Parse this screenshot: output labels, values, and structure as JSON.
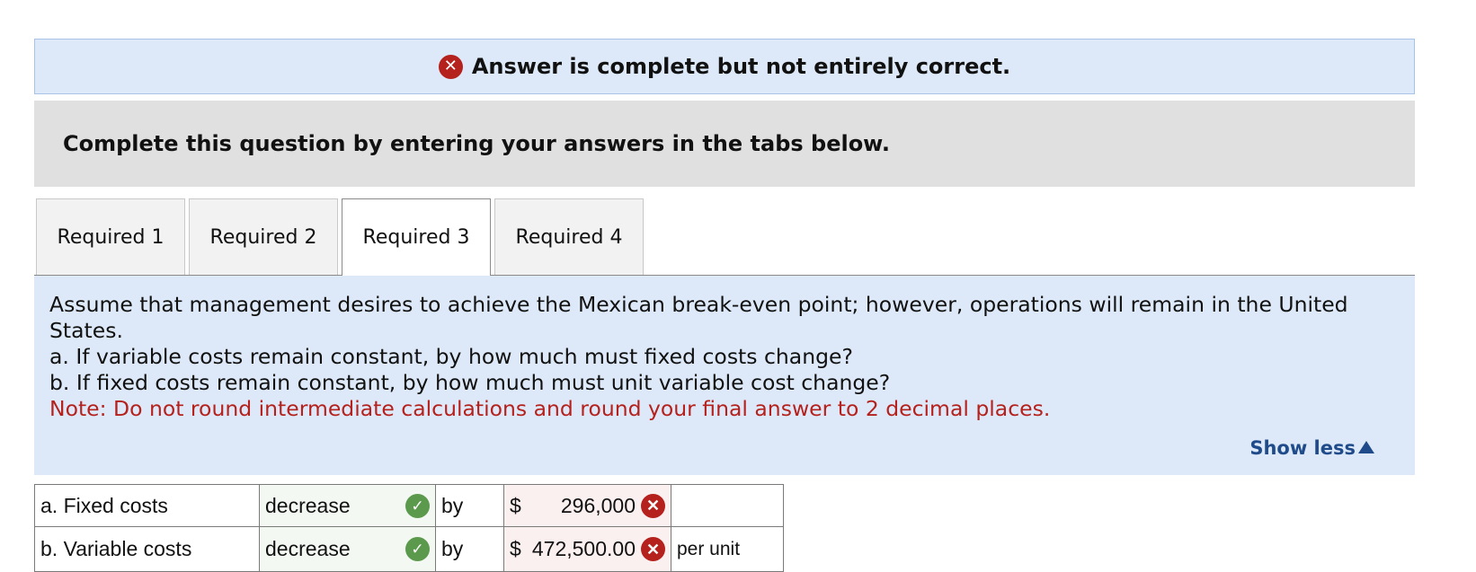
{
  "banner": {
    "text": "Answer is complete but not entirely correct."
  },
  "instructions": "Complete this question by entering your answers in the tabs below.",
  "tabs": [
    {
      "label": "Required 1"
    },
    {
      "label": "Required 2"
    },
    {
      "label": "Required 3"
    },
    {
      "label": "Required 4"
    }
  ],
  "active_tab": "Required 3",
  "question": {
    "line1": "Assume that management desires to achieve the Mexican break-even point; however, operations will remain in the United States.",
    "line2": "a. If variable costs remain constant, by how much must fixed costs change?",
    "line3": "b. If fixed costs remain constant, by how much must unit variable cost change?",
    "note": "Note: Do not round intermediate calculations and round your final answer to 2 decimal places."
  },
  "show_less": "Show less",
  "answers": [
    {
      "label": "a. Fixed costs",
      "direction": "decrease",
      "direction_status": "correct",
      "by": "by",
      "currency": "$",
      "amount": "296,000",
      "amount_status": "incorrect",
      "unit": ""
    },
    {
      "label": "b. Variable costs",
      "direction": "decrease",
      "direction_status": "correct",
      "by": "by",
      "currency": "$",
      "amount": "472,500.00",
      "amount_status": "incorrect",
      "unit": "per unit"
    }
  ],
  "colors": {
    "banner_bg": "#dde9f8",
    "incorrect": "#b5211d",
    "correct": "#5b9a4c",
    "link": "#1f4b8a"
  },
  "icons": {
    "incorrect": "x-circle-icon",
    "correct": "check-circle-icon",
    "show_less": "triangle-up-icon"
  }
}
